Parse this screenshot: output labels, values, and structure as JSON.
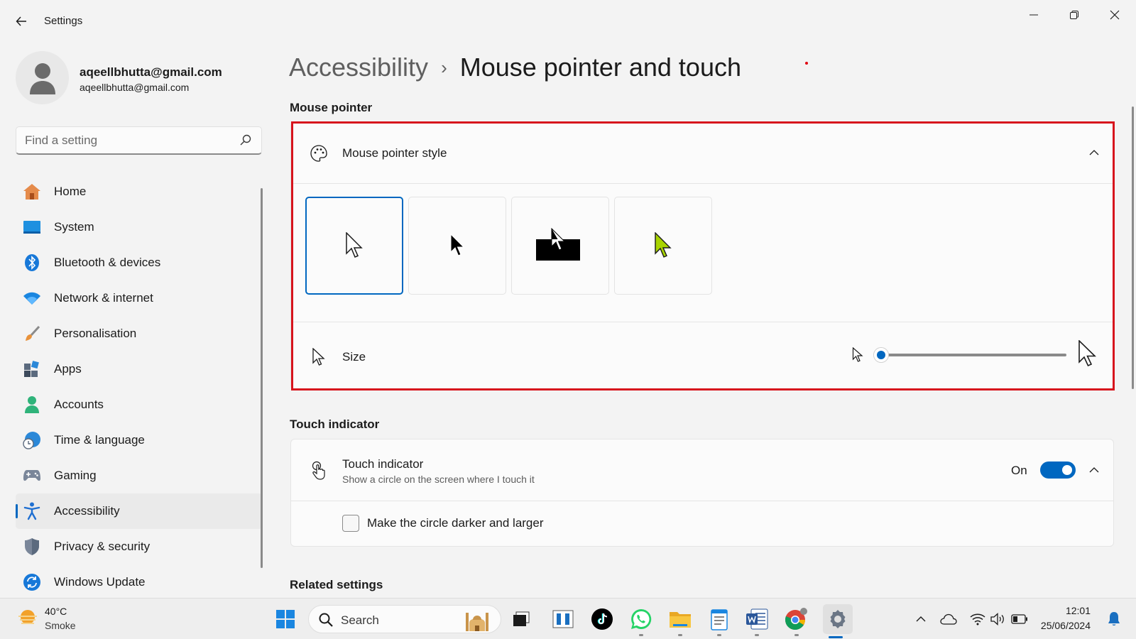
{
  "window": {
    "app_title": "Settings"
  },
  "profile": {
    "name": "aqeellbhutta@gmail.com",
    "email": "aqeellbhutta@gmail.com"
  },
  "search": {
    "placeholder": "Find a setting"
  },
  "sidebar": {
    "items": [
      {
        "label": "Home",
        "icon": "home-icon"
      },
      {
        "label": "System",
        "icon": "system-icon"
      },
      {
        "label": "Bluetooth & devices",
        "icon": "bluetooth-icon"
      },
      {
        "label": "Network & internet",
        "icon": "wifi-icon"
      },
      {
        "label": "Personalisation",
        "icon": "brush-icon"
      },
      {
        "label": "Apps",
        "icon": "apps-icon"
      },
      {
        "label": "Accounts",
        "icon": "account-icon"
      },
      {
        "label": "Time & language",
        "icon": "globe-clock-icon"
      },
      {
        "label": "Gaming",
        "icon": "gamepad-icon"
      },
      {
        "label": "Accessibility",
        "icon": "accessibility-icon",
        "active": true
      },
      {
        "label": "Privacy & security",
        "icon": "shield-icon"
      },
      {
        "label": "Windows Update",
        "icon": "update-icon"
      }
    ]
  },
  "main": {
    "breadcrumb_parent": "Accessibility",
    "breadcrumb_current": "Mouse pointer and touch",
    "mouse_pointer_heading": "Mouse pointer",
    "pointer_style_label": "Mouse pointer style",
    "pointer_styles": [
      "white",
      "black",
      "inverted",
      "custom"
    ],
    "selected_style": "white",
    "custom_color": "#a8d400",
    "size_label": "Size",
    "size_value_fraction": 0.0,
    "touch_heading": "Touch indicator",
    "touch_label": "Touch indicator",
    "touch_sub": "Show a circle on the screen where I touch it",
    "touch_state": "On",
    "darker_circle_label": "Make the circle darker and larger",
    "darker_circle_checked": false,
    "related_heading": "Related settings"
  },
  "taskbar": {
    "weather_temp": "40°C",
    "weather_desc": "Smoke",
    "search_label": "Search",
    "time": "12:01",
    "date": "25/06/2024"
  },
  "colors": {
    "accent": "#0067c0",
    "highlight_border": "#d7141d"
  }
}
